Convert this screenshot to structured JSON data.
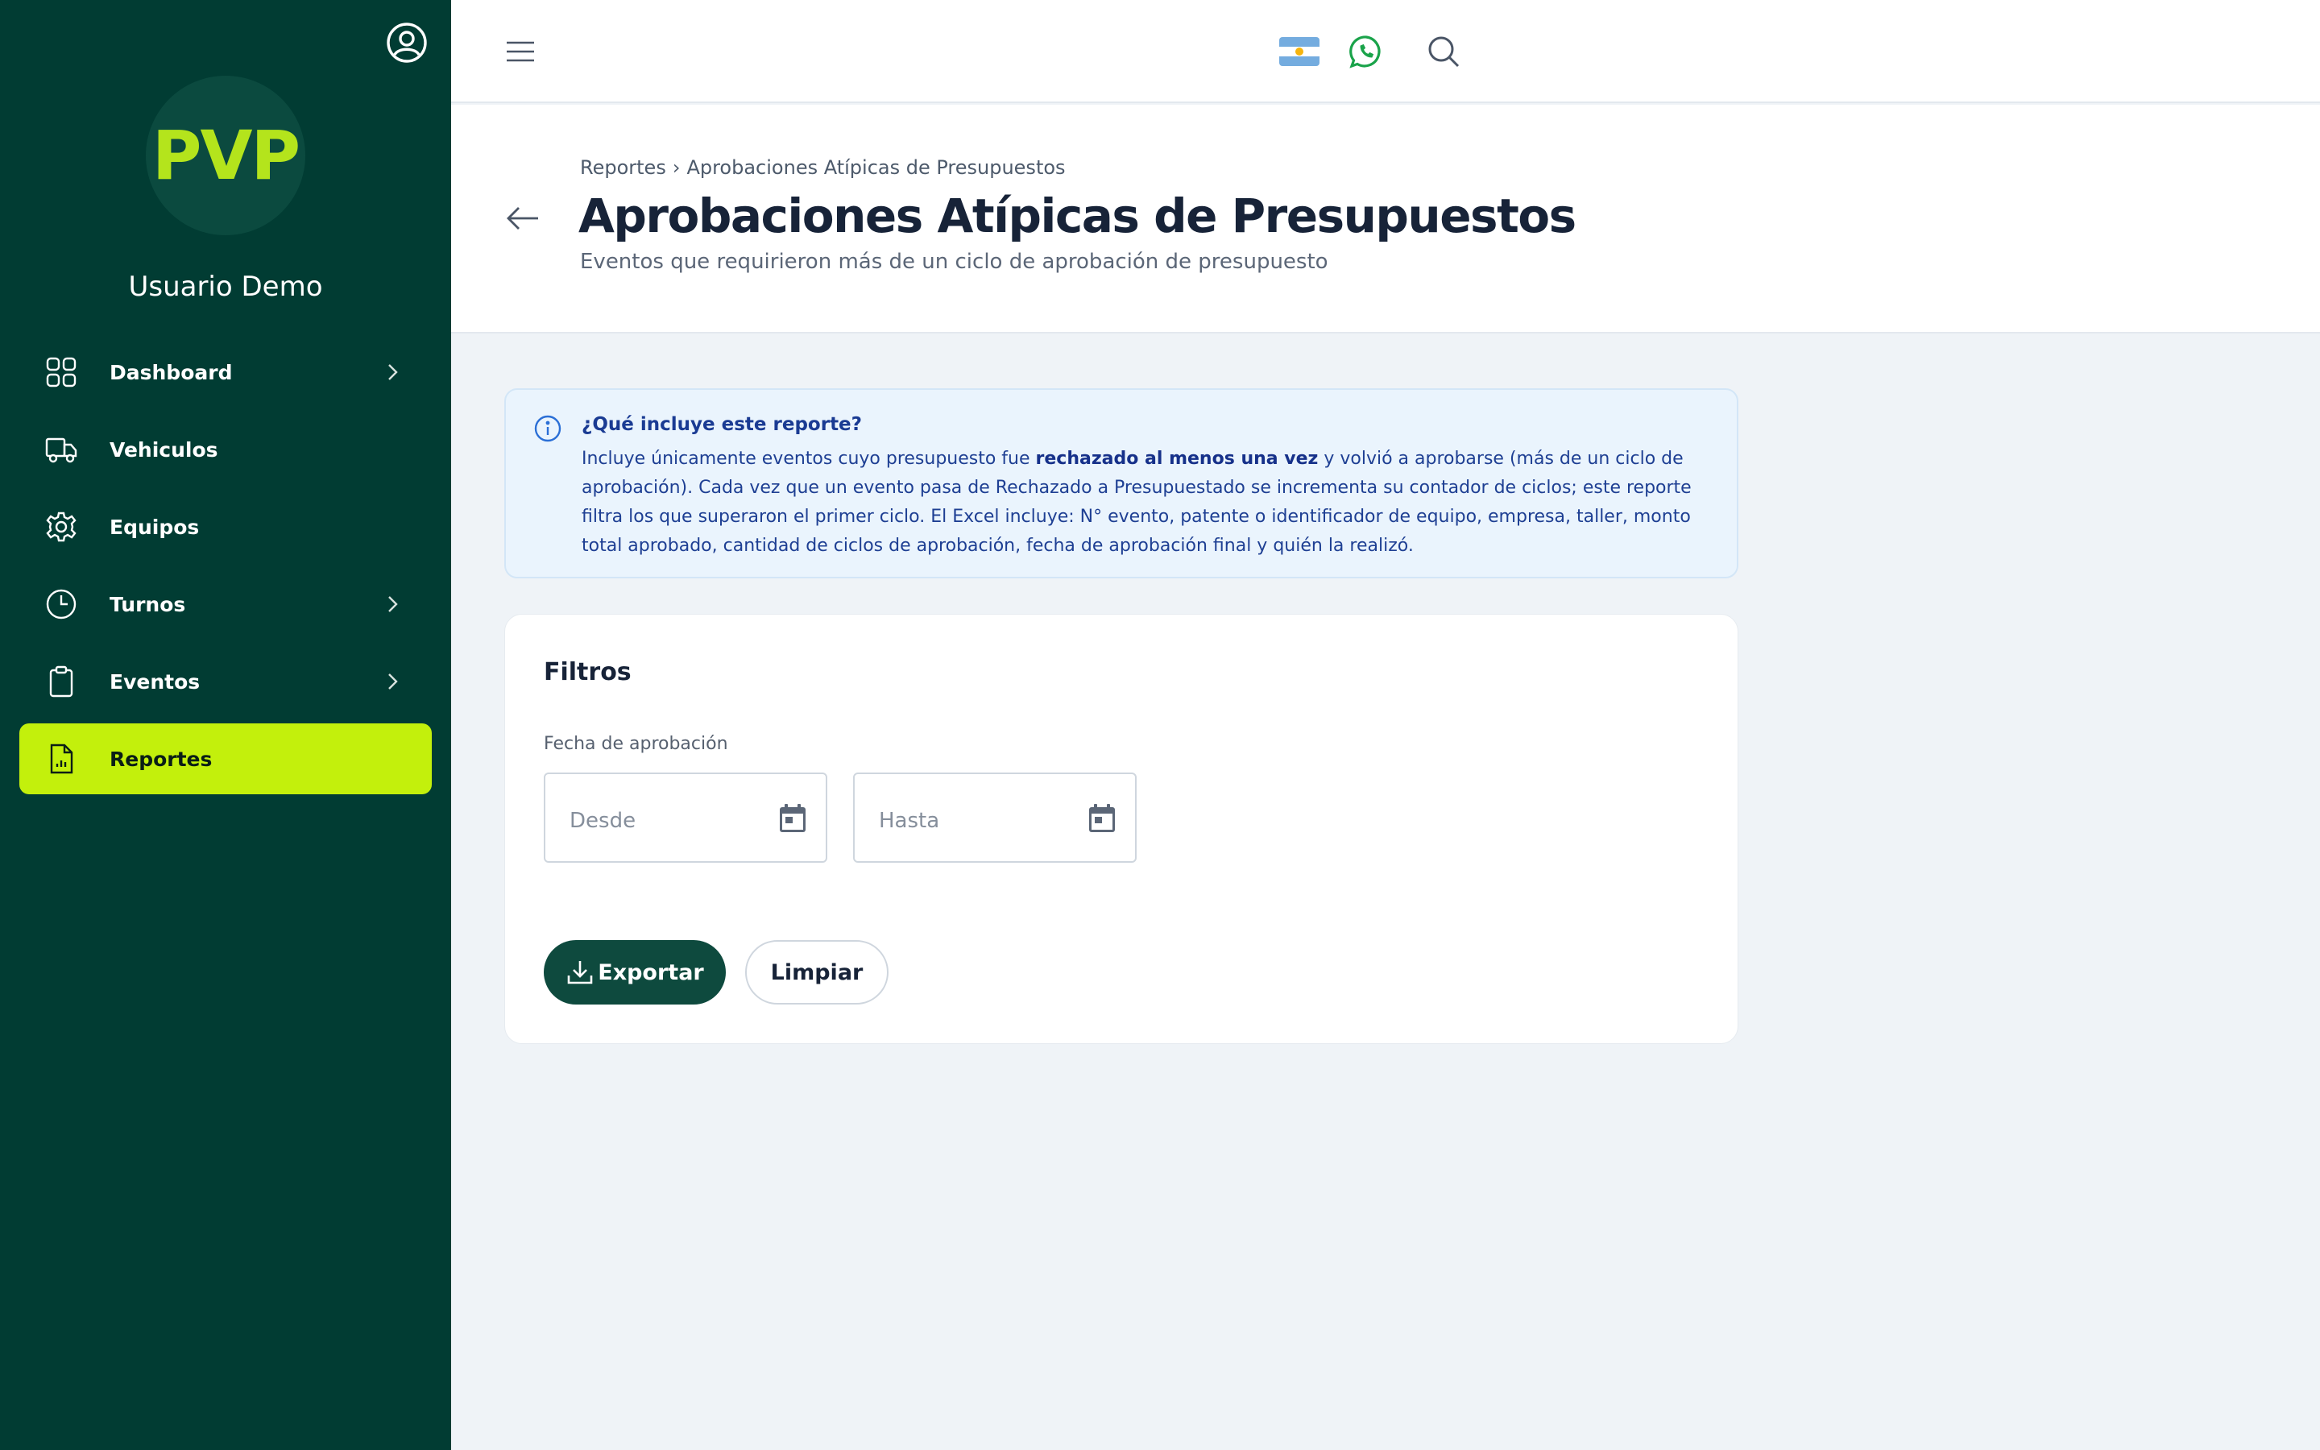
{
  "sidebar": {
    "logo_text": "PVP",
    "user_name": "Usuario Demo",
    "items": [
      {
        "label": "Dashboard",
        "icon": "grid-icon",
        "has_chevron": true
      },
      {
        "label": "Vehiculos",
        "icon": "truck-icon",
        "has_chevron": false
      },
      {
        "label": "Equipos",
        "icon": "gear-icon",
        "has_chevron": false
      },
      {
        "label": "Turnos",
        "icon": "clock-icon",
        "has_chevron": true
      },
      {
        "label": "Eventos",
        "icon": "clipboard-icon",
        "has_chevron": true
      },
      {
        "label": "Reportes",
        "icon": "report-icon",
        "has_chevron": false,
        "active": true
      }
    ]
  },
  "topbar": {
    "icons": [
      "menu-icon",
      "argentina-flag-icon",
      "whatsapp-icon",
      "search-icon"
    ]
  },
  "header": {
    "breadcrumb": [
      "Reportes",
      "Aprobaciones Atípicas de Presupuestos"
    ],
    "breadcrumb_separator": "›",
    "title": "Aprobaciones Atípicas de Presupuestos",
    "subtitle": "Eventos que requirieron más de un ciclo de aprobación de presupuesto"
  },
  "info": {
    "title": "¿Qué incluye este reporte?",
    "text_before": "Incluye únicamente eventos cuyo presupuesto fue ",
    "text_bold": "rechazado al menos una vez",
    "text_after": " y volvió a aprobarse (más de un ciclo de aprobación). Cada vez que un evento pasa de Rechazado a Presupuestado se incrementa su contador de ciclos; este reporte filtra los que superaron el primer ciclo. El Excel incluye: N° evento, patente o identificador de equipo, empresa, taller, monto total aprobado, cantidad de ciclos de aprobación, fecha de aprobación final y quién la realizó."
  },
  "filters": {
    "title": "Filtros",
    "date_label": "Fecha de aprobación",
    "from_placeholder": "Desde",
    "to_placeholder": "Hasta",
    "export_label": "Exportar",
    "clear_label": "Limpiar"
  },
  "colors": {
    "sidebar_bg": "#013c33",
    "accent": "#c3f00c",
    "primary_button": "#0e4a3e",
    "info_bg": "#eaf4fd",
    "info_text": "#1e3f93"
  }
}
